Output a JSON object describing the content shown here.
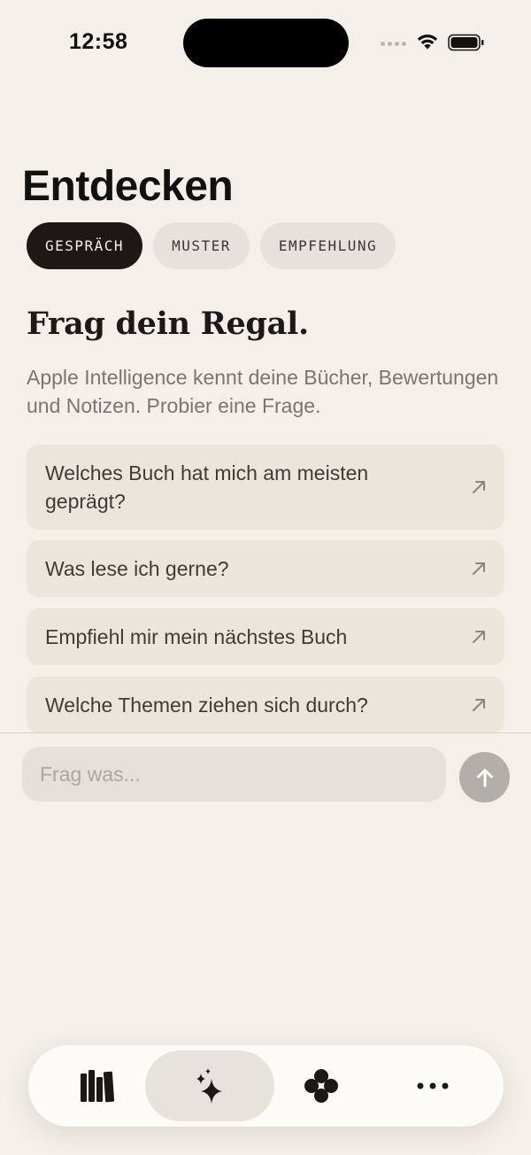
{
  "status_bar": {
    "time": "12:58"
  },
  "header": {
    "title": "Entdecken"
  },
  "tabs": [
    {
      "label": "GESPRÄCH",
      "active": true
    },
    {
      "label": "MUSTER",
      "active": false
    },
    {
      "label": "EMPFEHLUNG",
      "active": false
    }
  ],
  "intro": {
    "headline": "Frag dein Regal.",
    "description": "Apple Intelligence kennt deine Bücher, Bewertungen und Notizen. Probier eine Frage."
  },
  "suggestions": [
    {
      "text": "Welches Buch hat mich am meisten geprägt?",
      "icon": "arrow-up-right-icon"
    },
    {
      "text": "Was lese ich gerne?",
      "icon": "arrow-up-right-icon"
    },
    {
      "text": "Empfiehl mir mein nächstes Buch",
      "icon": "arrow-up-right-icon"
    },
    {
      "text": "Welche Themen ziehen sich durch?",
      "icon": "arrow-up-right-icon"
    }
  ],
  "input": {
    "placeholder": "Frag was...",
    "value": ""
  },
  "tab_bar": [
    {
      "icon": "books-icon",
      "active": false
    },
    {
      "icon": "sparkles-icon",
      "active": true
    },
    {
      "icon": "clover-icon",
      "active": false
    },
    {
      "icon": "more-icon",
      "active": false
    }
  ],
  "colors": {
    "background": "#f4f0e9",
    "active_tab": "#1c1815",
    "card": "#eae6dc",
    "send_button": "#b3aea7"
  }
}
